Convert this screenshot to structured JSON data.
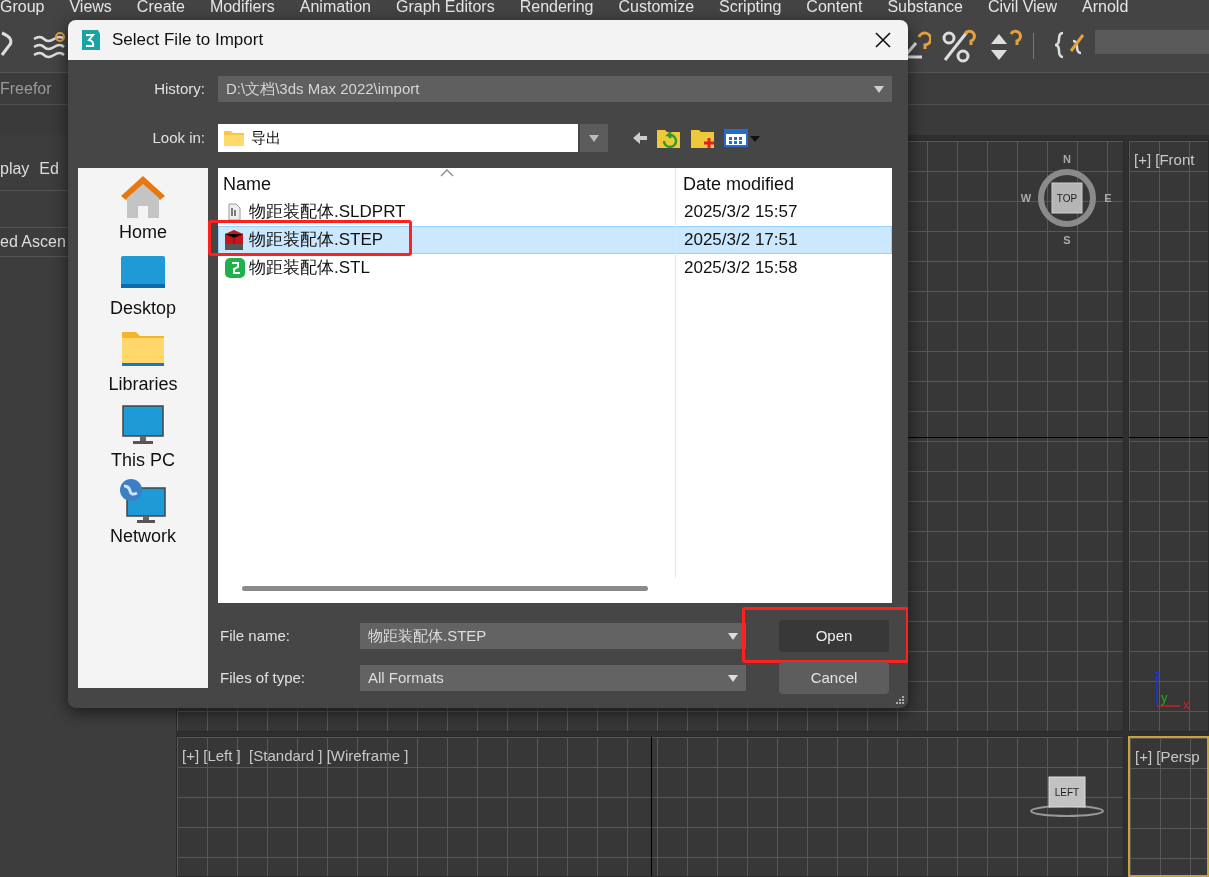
{
  "menu_bar": [
    {
      "label": "Group"
    },
    {
      "label": "Views"
    },
    {
      "label": "Create"
    },
    {
      "label": "Modifiers"
    },
    {
      "label": "Animation"
    },
    {
      "label": "Graph Editors"
    },
    {
      "label": "Rendering"
    },
    {
      "label": "Customize"
    },
    {
      "label": "Scripting"
    },
    {
      "label": "Content"
    },
    {
      "label": "Substance"
    },
    {
      "label": "Civil View"
    },
    {
      "label": "Arnold"
    }
  ],
  "ribbon_tab": "Freefor",
  "command_panel": {
    "tabs": [
      "play",
      "Ed"
    ],
    "item": "ed Ascen"
  },
  "viewports": [
    {
      "kind": "top",
      "active": false,
      "compass": [
        "N",
        "E",
        "S",
        "W"
      ],
      "cube_face": "TOP"
    },
    {
      "kind": "front",
      "label": "[+] [Front",
      "active": false,
      "axes": [
        "z",
        "y",
        "x"
      ]
    },
    {
      "kind": "left",
      "label": "[+] [Left ]  [Standard ] [Wireframe ]",
      "active": false,
      "cube_face": "LEFT"
    },
    {
      "kind": "perspective",
      "label": "[+] [Persp",
      "active": true
    }
  ],
  "dialog": {
    "title": "Select File to Import",
    "history_label": "History:",
    "history": "D:\\文档\\3ds Max 2022\\import",
    "look_in_label": "Look in:",
    "look_in": "导出",
    "places": [
      {
        "label": "Home",
        "kind": "home"
      },
      {
        "label": "Desktop",
        "kind": "desktop"
      },
      {
        "label": "Libraries",
        "kind": "libraries"
      },
      {
        "label": "This PC",
        "kind": "pc"
      },
      {
        "label": "Network",
        "kind": "network"
      }
    ],
    "columns": [
      "Name",
      "Date modified"
    ],
    "files": [
      {
        "name": "物距装配体.SLDPRT",
        "date": "2025/3/2 15:57",
        "kind": "part",
        "selected": false,
        "highlighted": false
      },
      {
        "name": "物距装配体.STEP",
        "date": "2025/3/2 17:51",
        "kind": "step",
        "selected": true,
        "highlighted": true
      },
      {
        "name": "物距装配体.STL",
        "date": "2025/3/2 15:58",
        "kind": "stl",
        "selected": false,
        "highlighted": false
      }
    ],
    "file_name_label": "File name:",
    "file_name": "物距装配体.STEP",
    "file_type_label": "Files of type:",
    "file_type": "All Formats",
    "buttons": [
      {
        "label": "Open",
        "kind": "primary",
        "highlighted": true
      },
      {
        "label": "Cancel",
        "kind": "secondary",
        "highlighted": false
      }
    ]
  }
}
